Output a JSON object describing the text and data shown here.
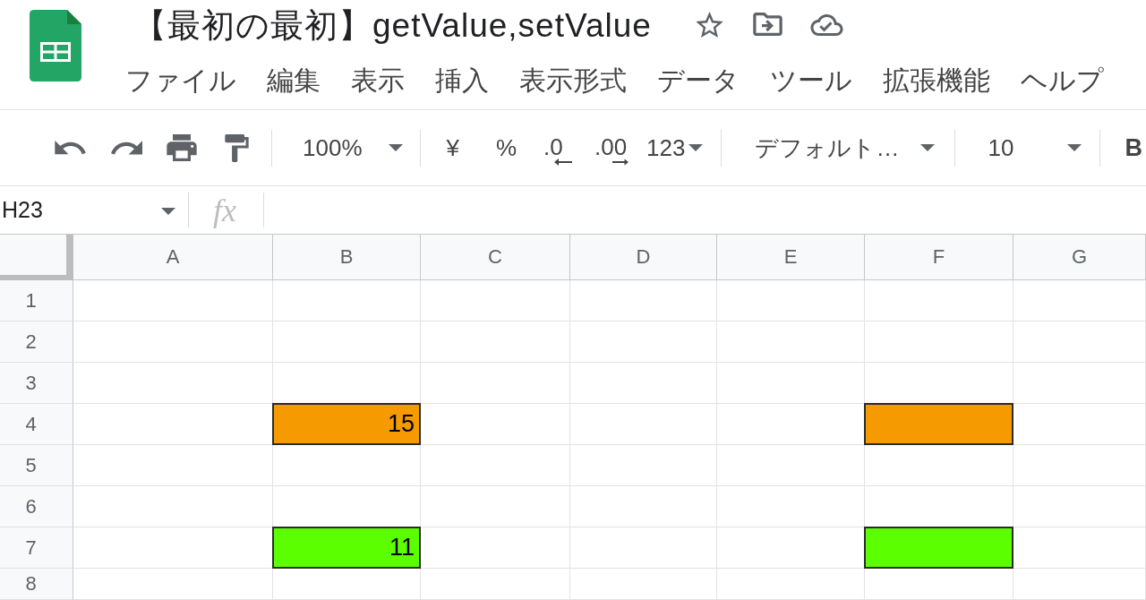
{
  "document": {
    "title": "【最初の最初】getValue,setValue"
  },
  "menu": [
    "ファイル",
    "編集",
    "表示",
    "挿入",
    "表示形式",
    "データ",
    "ツール",
    "拡張機能",
    "ヘルプ"
  ],
  "toolbar": {
    "zoom": "100%",
    "number_formats": [
      {
        "kind": "plain",
        "label": "¥"
      },
      {
        "kind": "plain",
        "label": "%"
      },
      {
        "kind": "decimal_decrease",
        "label": ".0"
      },
      {
        "kind": "decimal_increase",
        "label": ".00"
      },
      {
        "kind": "menu",
        "label": "123"
      }
    ],
    "font": "デフォルト…",
    "font_size": "10",
    "bold_button": "B"
  },
  "formula_bar": {
    "name_box": "H23",
    "function_label": "fx"
  },
  "sheet": {
    "columns": [
      "A",
      "B",
      "C",
      "D",
      "E",
      "F",
      "G"
    ],
    "rows": [
      {
        "label": "1",
        "cells": [
          {
            "kind": "blank"
          },
          {
            "kind": "blank"
          },
          {
            "kind": "blank"
          },
          {
            "kind": "blank"
          },
          {
            "kind": "blank"
          },
          {
            "kind": "blank"
          },
          {
            "kind": "blank"
          }
        ]
      },
      {
        "label": "2",
        "cells": [
          {
            "kind": "blank"
          },
          {
            "kind": "blank"
          },
          {
            "kind": "blank"
          },
          {
            "kind": "blank"
          },
          {
            "kind": "blank"
          },
          {
            "kind": "blank"
          },
          {
            "kind": "blank"
          }
        ]
      },
      {
        "label": "3",
        "cells": [
          {
            "kind": "blank"
          },
          {
            "kind": "blank"
          },
          {
            "kind": "blank"
          },
          {
            "kind": "blank"
          },
          {
            "kind": "blank"
          },
          {
            "kind": "blank"
          },
          {
            "kind": "blank"
          }
        ]
      },
      {
        "label": "4",
        "cells": [
          {
            "kind": "blank"
          },
          {
            "kind": "filled",
            "color": "#f59a00",
            "value": "15"
          },
          {
            "kind": "blank"
          },
          {
            "kind": "blank"
          },
          {
            "kind": "blank"
          },
          {
            "kind": "filled",
            "color": "#f59a00"
          },
          {
            "kind": "blank"
          }
        ]
      },
      {
        "label": "5",
        "cells": [
          {
            "kind": "blank"
          },
          {
            "kind": "blank"
          },
          {
            "kind": "blank"
          },
          {
            "kind": "blank"
          },
          {
            "kind": "blank"
          },
          {
            "kind": "blank"
          },
          {
            "kind": "blank"
          }
        ]
      },
      {
        "label": "6",
        "cells": [
          {
            "kind": "blank"
          },
          {
            "kind": "blank"
          },
          {
            "kind": "blank"
          },
          {
            "kind": "blank"
          },
          {
            "kind": "blank"
          },
          {
            "kind": "blank"
          },
          {
            "kind": "blank"
          }
        ]
      },
      {
        "label": "7",
        "cells": [
          {
            "kind": "blank"
          },
          {
            "kind": "filled",
            "color": "#5cff00",
            "value": "11"
          },
          {
            "kind": "blank"
          },
          {
            "kind": "blank"
          },
          {
            "kind": "blank"
          },
          {
            "kind": "filled",
            "color": "#5cff00"
          },
          {
            "kind": "blank"
          }
        ]
      },
      {
        "label": "8",
        "cells": [
          {
            "kind": "blank"
          },
          {
            "kind": "blank"
          },
          {
            "kind": "blank"
          },
          {
            "kind": "blank"
          },
          {
            "kind": "blank"
          },
          {
            "kind": "blank"
          },
          {
            "kind": "blank"
          }
        ]
      }
    ]
  }
}
